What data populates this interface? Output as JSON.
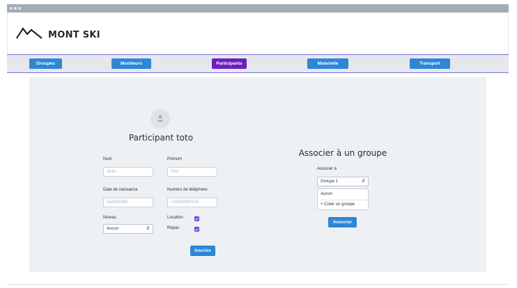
{
  "header": {
    "brand": "MONT SKI"
  },
  "nav": {
    "items": [
      {
        "label": "Groupes"
      },
      {
        "label": "Moniteurs"
      },
      {
        "label": "Participants"
      },
      {
        "label": "Materielle"
      },
      {
        "label": "Transport"
      }
    ],
    "active": "Participants"
  },
  "form": {
    "title": "Participant toto",
    "nom": {
      "label": "Nom",
      "placeholder": "Jean"
    },
    "prenom": {
      "label": "Prénom",
      "placeholder": "Toto"
    },
    "date": {
      "label": "Date de naissance",
      "placeholder": "15/09/1990"
    },
    "phone": {
      "label": "Numéro de téléphone",
      "placeholder": "+33562087025"
    },
    "niveau": {
      "label": "Niveau",
      "value": "Aucun"
    },
    "location": {
      "label": "Location",
      "checked": true
    },
    "repas": {
      "label": "Repas",
      "checked": true
    },
    "submit": "Inscrire"
  },
  "group": {
    "title": "Associer à un groupe",
    "label": "Associer à",
    "selected": "Groupe 1",
    "options": [
      "Aucun",
      "+ Créer un groupe"
    ],
    "submit": "Associer"
  },
  "colors": {
    "primary": "#2d86d6",
    "active": "#6c1fbf",
    "checkbox": "#6a3fd8",
    "panel": "#eef1f4"
  }
}
